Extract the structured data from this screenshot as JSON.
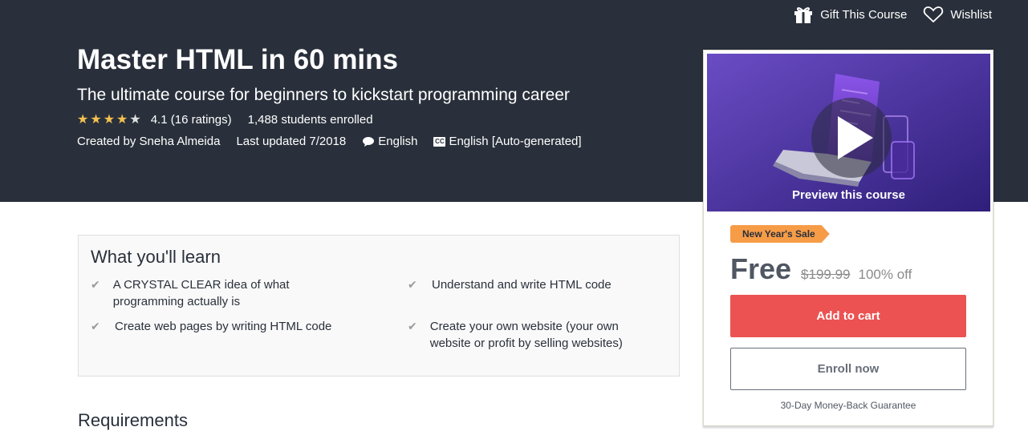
{
  "actions": {
    "gift_label": "Gift This Course",
    "wishlist_label": "Wishlist"
  },
  "course": {
    "title": "Master HTML in 60 mins",
    "subtitle": "The ultimate course for beginners to kickstart programming career",
    "rating_text": "4.1 (16 ratings)",
    "rating_value": 4.1,
    "students": "1,488 students enrolled",
    "created_by": "Created by Sneha Almeida",
    "last_updated": "Last updated 7/2018",
    "language": "English",
    "captions": "English [Auto-generated]",
    "captions_icon_text": "CC"
  },
  "sidebar": {
    "preview_label": "Preview this course",
    "sale_badge": "New Year's Sale",
    "price": "Free",
    "original_price": "$199.99",
    "discount": "100% off",
    "add_to_cart": "Add to cart",
    "enroll_now": "Enroll now",
    "guarantee": "30-Day Money-Back Guarantee"
  },
  "learn": {
    "title": "What you'll learn",
    "items": [
      "A CRYSTAL CLEAR idea of what programming actually is",
      "Understand and write HTML code",
      "Create web pages by writing HTML code",
      "Create your own website (your own website or profit by selling websites)"
    ]
  },
  "requirements": {
    "title": "Requirements"
  },
  "colors": {
    "hero_bg": "#29303b",
    "cart_button": "#ec5252",
    "sale_badge": "#f69c47",
    "star": "#f4c150"
  }
}
